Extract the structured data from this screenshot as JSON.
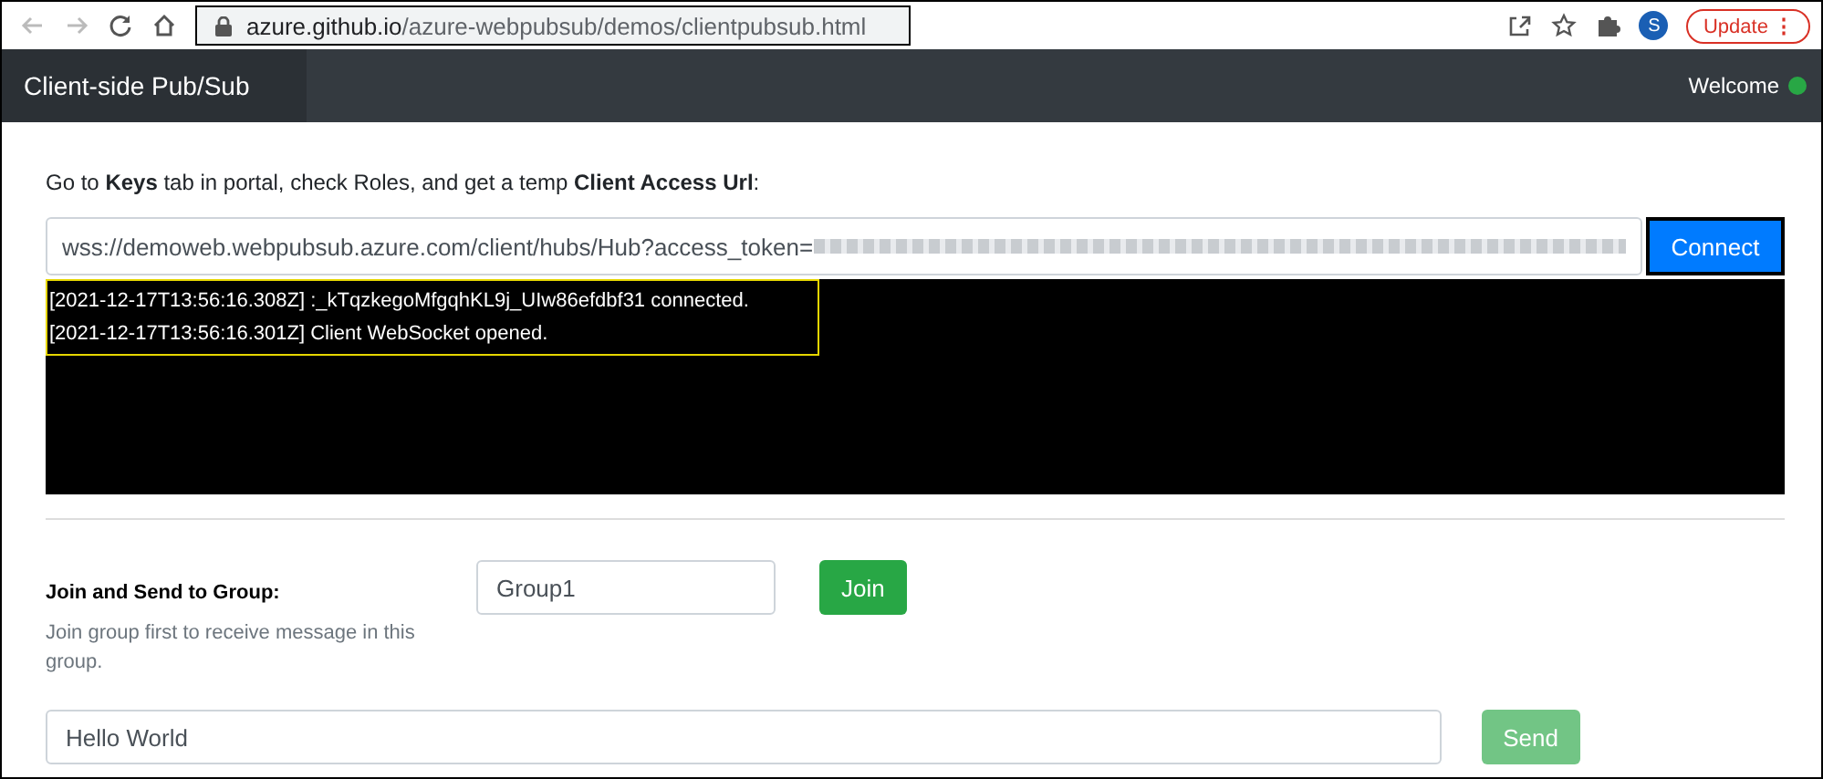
{
  "browser": {
    "url_host": "azure.github.io",
    "url_path": "/azure-webpubsub/demos/clientpubsub.html",
    "profile_initial": "S",
    "update_label": "Update",
    "menu_glyph": "⋮"
  },
  "navbar": {
    "brand": "Client-side Pub/Sub",
    "welcome": "Welcome",
    "online": true
  },
  "instruction": "Go to **Keys** tab in portal, check Roles, and get a temp **Client Access Url**:",
  "url_field": {
    "value": "wss://demoweb.webpubsub.azure.com/client/hubs/Hub?access_token=",
    "redacted": true
  },
  "connect_button": {
    "label": "Connect",
    "disabled": false
  },
  "log": [
    {
      "text": "[2021-12-17T13:56:16.308Z] :_kTqzkegoMfgqhKL9j_UIw86efdbf31 connected."
    },
    {
      "text": "[2021-12-17T13:56:16.301Z] Client WebSocket opened."
    }
  ],
  "group_section": {
    "title": "Join and Send to Group:",
    "hint": "Join group first to receive message in this group.",
    "group_field": {
      "value": "Group1"
    },
    "join_button": {
      "label": "Join",
      "disabled": false
    }
  },
  "message_field": {
    "value": "Hello World"
  },
  "send_button": {
    "label": "Send",
    "disabled": true
  }
}
